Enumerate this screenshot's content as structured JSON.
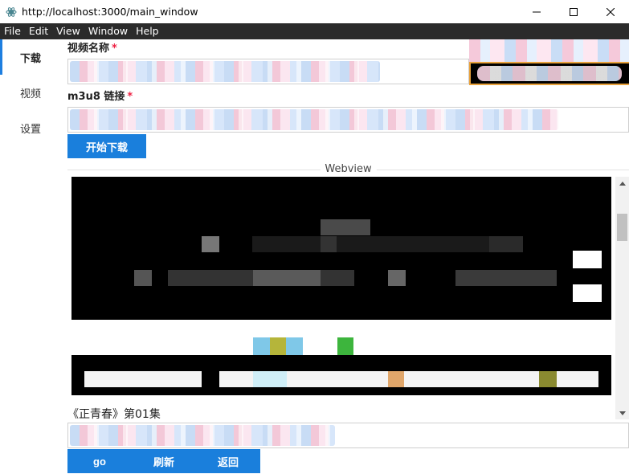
{
  "window": {
    "title": "http://localhost:3000/main_window"
  },
  "menubar": {
    "items": [
      "File",
      "Edit",
      "View",
      "Window",
      "Help"
    ]
  },
  "sidebar": {
    "items": [
      {
        "label": "下载",
        "active": true
      },
      {
        "label": "视频",
        "active": false
      },
      {
        "label": "设置",
        "active": false
      }
    ]
  },
  "form": {
    "video_name_label": "视频名称",
    "m3u8_label": "m3u8 链接",
    "required_mark": "*",
    "start_download_button": "开始下载"
  },
  "webview_section": {
    "divider_text": "Webview"
  },
  "player": {
    "episode_title": "《正青春》第01集"
  },
  "bottom_bar": {
    "go_button": "go",
    "refresh_button": "刷新",
    "back_button": "返回"
  },
  "colors": {
    "accent": "#1a7fdc",
    "menubar_bg": "#2b2b2b",
    "required": "#e24444",
    "focus_border": "#e9a23b"
  },
  "icons": {
    "app": "electron-icon",
    "minimize": "minimize-icon",
    "maximize": "maximize-icon",
    "close": "close-icon",
    "scroll_up": "arrow-up-icon",
    "scroll_down": "arrow-down-icon"
  }
}
